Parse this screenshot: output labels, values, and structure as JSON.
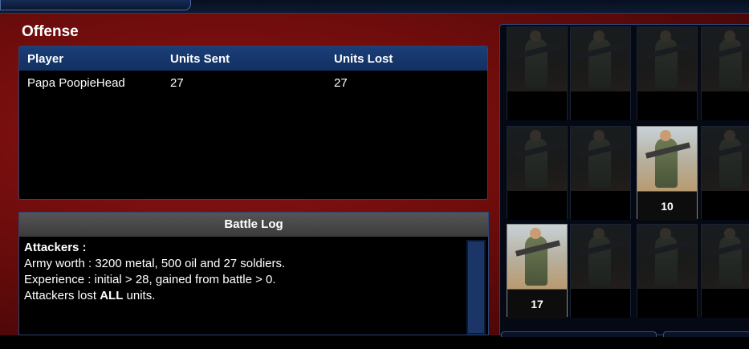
{
  "offense": {
    "title": "Offense",
    "columns": [
      "Player",
      "Units Sent",
      "Units Lost"
    ],
    "rows": [
      {
        "player": "Papa PoopieHead",
        "units_sent": "27",
        "units_lost": "27"
      }
    ]
  },
  "battle_log": {
    "title": "Battle Log",
    "lines": [
      "Attackers :",
      "Army worth : 3200 metal, 500 oil and 27 soldiers.",
      "Experience : initial > 28, gained from battle > 0.",
      "Attackers lost ALL units."
    ]
  },
  "units": [
    {
      "row": 0,
      "col": 0,
      "count": "",
      "active": false
    },
    {
      "row": 0,
      "col": 1,
      "count": "",
      "active": false
    },
    {
      "row": 0,
      "col": 2,
      "count": "",
      "active": false
    },
    {
      "row": 0,
      "col": 3,
      "count": "",
      "active": false
    },
    {
      "row": 1,
      "col": 0,
      "count": "",
      "active": false
    },
    {
      "row": 1,
      "col": 1,
      "count": "",
      "active": false
    },
    {
      "row": 1,
      "col": 2,
      "count": "10",
      "active": true
    },
    {
      "row": 1,
      "col": 3,
      "count": "",
      "active": false
    },
    {
      "row": 2,
      "col": 0,
      "count": "17",
      "active": true
    },
    {
      "row": 2,
      "col": 1,
      "count": "",
      "active": false
    },
    {
      "row": 2,
      "col": 2,
      "count": "",
      "active": false
    },
    {
      "row": 2,
      "col": 3,
      "count": "",
      "active": false
    }
  ],
  "colors": {
    "panel_red": "#8e1414",
    "table_header_blue": "#1a3e78",
    "log_header_gray": "#555555"
  }
}
